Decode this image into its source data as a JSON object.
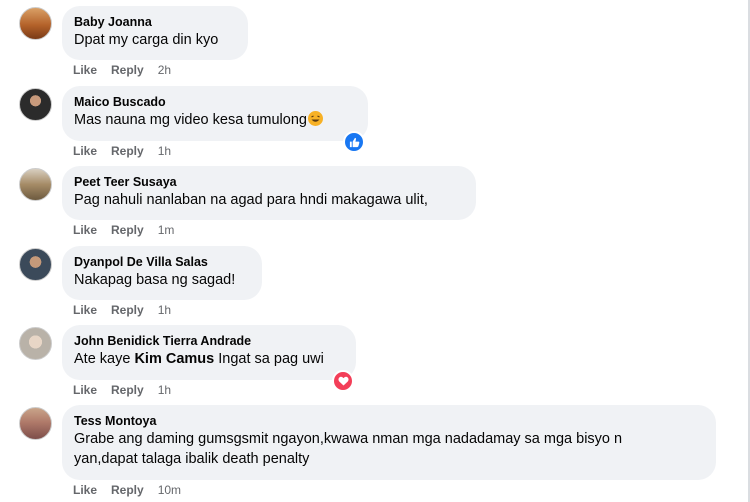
{
  "actions": {
    "like": "Like",
    "reply": "Reply"
  },
  "comments": [
    {
      "author": "Baby Joanna",
      "text": "Dpat my carga din kyo",
      "time": "2h"
    },
    {
      "author": "Maico Buscado",
      "text": "Mas nauna mg video kesa tumulong",
      "time": "1h",
      "emoji": "laughing-face-icon",
      "reaction": "like-reaction-icon"
    },
    {
      "author": "Peet Teer Susaya",
      "text": "Pag nahuli nanlaban na agad para hndi makagawa ulit,",
      "time": "1m"
    },
    {
      "author": "Dyanpol De Villa Salas",
      "text": "Nakapag basa ng sagad!",
      "time": "1h"
    },
    {
      "author": "John Benidick Tierra Andrade",
      "text_before": "Ate kaye ",
      "mention": "Kim Camus",
      "text_after": " Ingat sa pag uwi",
      "time": "1h",
      "reaction": "heart-reaction-icon"
    },
    {
      "author": "Tess Montoya",
      "text_line1": "Grabe ang daming gumsgsmit ngayon,kwawa nman mga nadadamay sa mga bisyo n",
      "text_line2": "yan,dapat talaga ibalik death penalty",
      "time": "10m"
    }
  ],
  "colors": {
    "bubble": "#f0f2f5",
    "meta": "#65676b",
    "like_blue": "#1877f2",
    "love_red": "#f33e58"
  }
}
